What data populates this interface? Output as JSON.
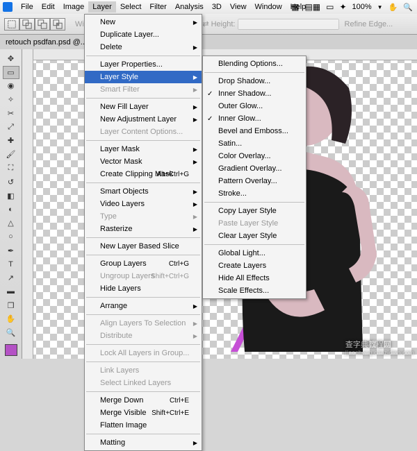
{
  "menubar": {
    "items": [
      "File",
      "Edit",
      "Image",
      "Layer",
      "Select",
      "Filter",
      "Analysis",
      "3D",
      "View",
      "Window",
      "Help"
    ],
    "active_index": 3
  },
  "topstrip": {
    "zoom": "100%",
    "width_label": "Width:",
    "height_label": "Height:",
    "refine_label": "Refine Edge..."
  },
  "doc": {
    "title": "retouch psdfan.psd @..."
  },
  "layer_menu": [
    {
      "t": "item",
      "label": "New",
      "arrow": true
    },
    {
      "t": "item",
      "label": "Duplicate Layer..."
    },
    {
      "t": "item",
      "label": "Delete",
      "arrow": true
    },
    {
      "t": "sep"
    },
    {
      "t": "item",
      "label": "Layer Properties..."
    },
    {
      "t": "item",
      "label": "Layer Style",
      "arrow": true,
      "highlight": true
    },
    {
      "t": "item",
      "label": "Smart Filter",
      "arrow": true,
      "disabled": true
    },
    {
      "t": "sep"
    },
    {
      "t": "item",
      "label": "New Fill Layer",
      "arrow": true
    },
    {
      "t": "item",
      "label": "New Adjustment Layer",
      "arrow": true
    },
    {
      "t": "item",
      "label": "Layer Content Options...",
      "disabled": true
    },
    {
      "t": "sep"
    },
    {
      "t": "item",
      "label": "Layer Mask",
      "arrow": true
    },
    {
      "t": "item",
      "label": "Vector Mask",
      "arrow": true
    },
    {
      "t": "item",
      "label": "Create Clipping Mask",
      "shortcut": "Alt+Ctrl+G"
    },
    {
      "t": "sep"
    },
    {
      "t": "item",
      "label": "Smart Objects",
      "arrow": true
    },
    {
      "t": "item",
      "label": "Video Layers",
      "arrow": true
    },
    {
      "t": "item",
      "label": "Type",
      "arrow": true,
      "disabled": true
    },
    {
      "t": "item",
      "label": "Rasterize",
      "arrow": true
    },
    {
      "t": "sep"
    },
    {
      "t": "item",
      "label": "New Layer Based Slice"
    },
    {
      "t": "sep"
    },
    {
      "t": "item",
      "label": "Group Layers",
      "shortcut": "Ctrl+G"
    },
    {
      "t": "item",
      "label": "Ungroup Layers",
      "shortcut": "Shift+Ctrl+G",
      "disabled": true
    },
    {
      "t": "item",
      "label": "Hide Layers"
    },
    {
      "t": "sep"
    },
    {
      "t": "item",
      "label": "Arrange",
      "arrow": true
    },
    {
      "t": "sep"
    },
    {
      "t": "item",
      "label": "Align Layers To Selection",
      "arrow": true,
      "disabled": true
    },
    {
      "t": "item",
      "label": "Distribute",
      "arrow": true,
      "disabled": true
    },
    {
      "t": "sep"
    },
    {
      "t": "item",
      "label": "Lock All Layers in Group...",
      "disabled": true
    },
    {
      "t": "sep"
    },
    {
      "t": "item",
      "label": "Link Layers",
      "disabled": true
    },
    {
      "t": "item",
      "label": "Select Linked Layers",
      "disabled": true
    },
    {
      "t": "sep"
    },
    {
      "t": "item",
      "label": "Merge Down",
      "shortcut": "Ctrl+E"
    },
    {
      "t": "item",
      "label": "Merge Visible",
      "shortcut": "Shift+Ctrl+E"
    },
    {
      "t": "item",
      "label": "Flatten Image"
    },
    {
      "t": "sep"
    },
    {
      "t": "item",
      "label": "Matting",
      "arrow": true
    }
  ],
  "style_menu": [
    {
      "t": "item",
      "label": "Blending Options..."
    },
    {
      "t": "sep"
    },
    {
      "t": "item",
      "label": "Drop Shadow..."
    },
    {
      "t": "item",
      "label": "Inner Shadow...",
      "checked": true
    },
    {
      "t": "item",
      "label": "Outer Glow..."
    },
    {
      "t": "item",
      "label": "Inner Glow...",
      "checked": true
    },
    {
      "t": "item",
      "label": "Bevel and Emboss..."
    },
    {
      "t": "item",
      "label": "Satin..."
    },
    {
      "t": "item",
      "label": "Color Overlay..."
    },
    {
      "t": "item",
      "label": "Gradient Overlay..."
    },
    {
      "t": "item",
      "label": "Pattern Overlay..."
    },
    {
      "t": "item",
      "label": "Stroke..."
    },
    {
      "t": "sep"
    },
    {
      "t": "item",
      "label": "Copy Layer Style"
    },
    {
      "t": "item",
      "label": "Paste Layer Style",
      "disabled": true
    },
    {
      "t": "item",
      "label": "Clear Layer Style"
    },
    {
      "t": "sep"
    },
    {
      "t": "item",
      "label": "Global Light..."
    },
    {
      "t": "item",
      "label": "Create Layers"
    },
    {
      "t": "item",
      "label": "Hide All Effects"
    },
    {
      "t": "item",
      "label": "Scale Effects..."
    }
  ],
  "swatches": {
    "fg": "#b452c5",
    "bg": "#ffffff"
  },
  "watermark": {
    "main": "查字典教程网",
    "sub": "jiaocheng.chazidian.com"
  }
}
